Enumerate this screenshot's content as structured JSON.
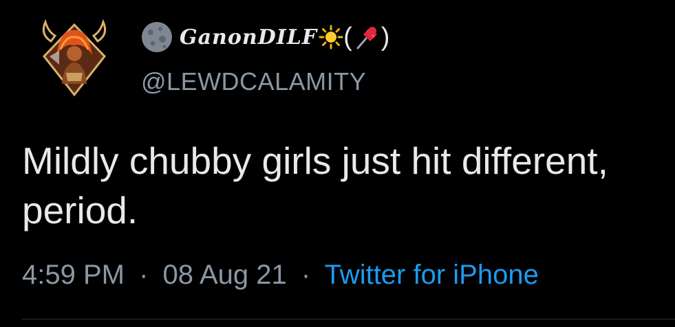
{
  "tweet": {
    "display_name": "GanonDILF",
    "paren_open": "(",
    "paren_close": ")",
    "handle": "@LEWDCALAMITY",
    "text": "Mildly chubby girls just hit different, period.",
    "time": "4:59 PM",
    "separator": "·",
    "date": "08 Aug 21",
    "source": "Twitter for iPhone",
    "icons": [
      "avatar",
      "new-moon-emoji-icon",
      "sun-emoji-icon",
      "pushpin-emoji-icon"
    ]
  },
  "colors": {
    "background": "#000000",
    "primary_text": "#e7e9ea",
    "secondary_text": "#8b98a5",
    "link": "#1d9bf0",
    "divider": "#2f3336"
  }
}
